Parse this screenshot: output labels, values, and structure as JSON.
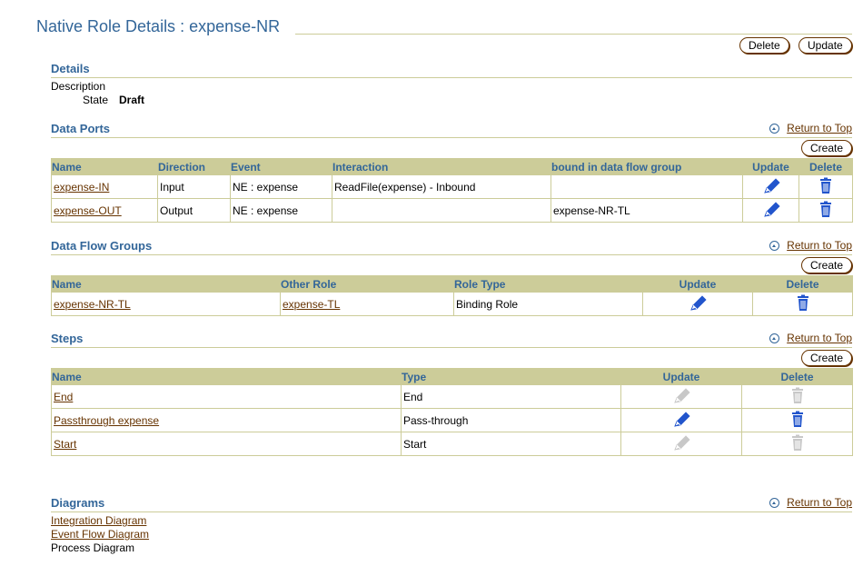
{
  "page": {
    "title": "Native Role Details : expense-NR"
  },
  "header_buttons": {
    "delete": "Delete",
    "update": "Update"
  },
  "return_to_top": "Return to Top",
  "create_label": "Create",
  "details": {
    "heading": "Details",
    "description_label": "Description",
    "state_label": "State",
    "state_value": "Draft"
  },
  "data_ports": {
    "heading": "Data Ports",
    "columns": [
      "Name",
      "Direction",
      "Event",
      "Interaction",
      "bound in data flow group",
      "Update",
      "Delete"
    ],
    "rows": [
      {
        "name": "expense-IN",
        "direction": "Input",
        "event": "NE : expense",
        "interaction": "ReadFile(expense) - Inbound",
        "bound": ""
      },
      {
        "name": "expense-OUT",
        "direction": "Output",
        "event": "NE : expense",
        "interaction": "",
        "bound": "expense-NR-TL"
      }
    ]
  },
  "data_flow_groups": {
    "heading": "Data Flow Groups",
    "columns": [
      "Name",
      "Other Role",
      "Role Type",
      "Update",
      "Delete"
    ],
    "rows": [
      {
        "name": "expense-NR-TL",
        "other_role": "expense-TL",
        "role_type": "Binding Role"
      }
    ]
  },
  "steps": {
    "heading": "Steps",
    "columns": [
      "Name",
      "Type",
      "Update",
      "Delete"
    ],
    "rows": [
      {
        "name": "End",
        "type": "End",
        "enabled": false
      },
      {
        "name": "Passthrough expense",
        "type": "Pass-through",
        "enabled": true
      },
      {
        "name": "Start",
        "type": "Start",
        "enabled": false
      }
    ]
  },
  "diagrams": {
    "heading": "Diagrams",
    "integration": "Integration Diagram",
    "event_flow": "Event Flow Diagram",
    "process": "Process Diagram"
  },
  "icons": {
    "return_top": "return-to-top-icon",
    "pencil": "pencil-icon",
    "trash": "trash-icon"
  },
  "colors": {
    "title_blue": "#336699",
    "link_brown": "#663300",
    "header_bg": "#cccc99",
    "icon_active": "#2255cc",
    "icon_disabled": "#c8c8c8"
  }
}
